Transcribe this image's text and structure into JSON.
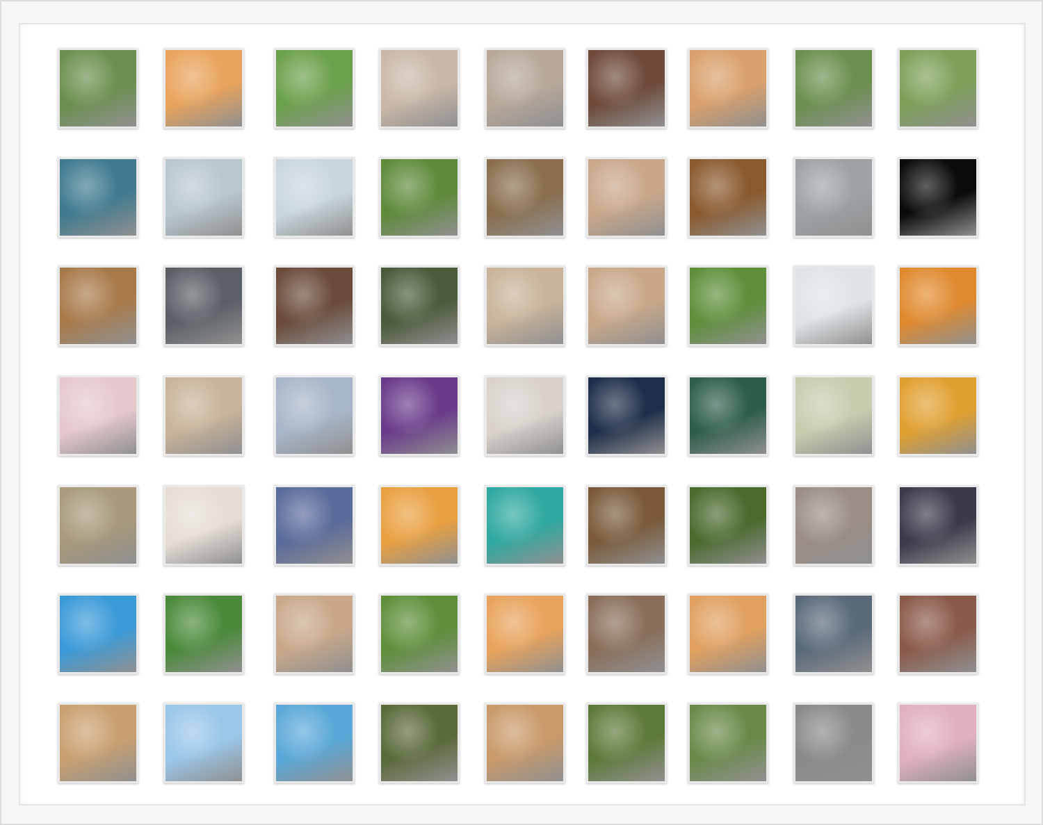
{
  "collage": {
    "rows": 7,
    "cols": 9,
    "palette": [
      [
        "#6b8f4e",
        "#e8a35c",
        "#6aa04a",
        "#c9b8a8",
        "#b7a89a",
        "#6e4a3a",
        "#d9a06b",
        "#6b8f4e",
        "#7ea059"
      ],
      [
        "#3f7a8f",
        "#b9c7cf",
        "#c9d7dd",
        "#5e8a3a",
        "#8a6e4e",
        "#c9a78a",
        "#8a5a2e",
        "#9ea2a6",
        "#0b0b0b"
      ],
      [
        "#a87a4a",
        "#5a5f66",
        "#6a4a3a",
        "#4a5a3a",
        "#c9b39a",
        "#c9a88a",
        "#5e8f3a",
        "#dfe3e6",
        "#e08a2e"
      ],
      [
        "#e6c8cc",
        "#c9b39a",
        "#a8b6c9",
        "#6a3a8a",
        "#d9d2cc",
        "#1e2e4a",
        "#2e5e4a",
        "#c9ccaf",
        "#e0a030"
      ],
      [
        "#a89a7a",
        "#e6ded6",
        "#5a6a9a",
        "#e9a040",
        "#2ea8a0",
        "#7a5a3a",
        "#4a6a2e",
        "#9a8e86",
        "#3a3a4a"
      ],
      [
        "#3a9ad8",
        "#4a8a3a",
        "#c9a88a",
        "#5e8f3a",
        "#e8a35c",
        "#8a6e5a",
        "#e0a060",
        "#5a6a7a",
        "#8a5a4a"
      ],
      [
        "#c9a070",
        "#9ac6e8",
        "#5aa8d8",
        "#5a6a3a",
        "#c99a6a",
        "#5e7a3a",
        "#6a8a4a",
        "#8a8a8a",
        "#e0b0c0"
      ]
    ]
  }
}
